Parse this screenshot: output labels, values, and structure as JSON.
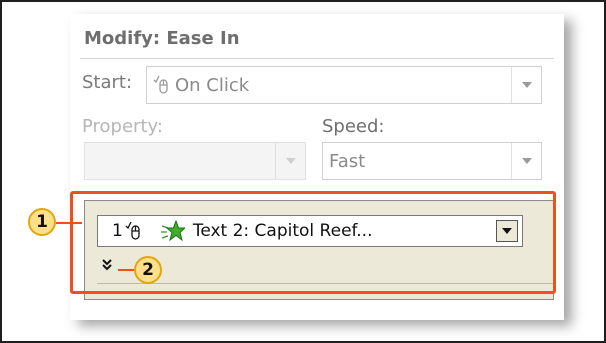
{
  "task_pane": {
    "title": "Modify: Ease In",
    "start": {
      "label": "Start:",
      "value": "On Click",
      "icon": "mouse-icon"
    },
    "property": {
      "label": "Property:",
      "value": ""
    },
    "speed": {
      "label": "Speed:",
      "value": "Fast"
    }
  },
  "animation_list": {
    "items": [
      {
        "number": "1",
        "trigger_icon": "mouse-icon",
        "effect_icon": "entrance-star-icon",
        "label": "Text 2: Capitol Reef..."
      }
    ],
    "expand_icon": "double-chevron-down-icon"
  },
  "callouts": [
    {
      "label": "1"
    },
    {
      "label": "2"
    }
  ],
  "colors": {
    "highlight": "#f0501e",
    "callout_fill": "#fde089",
    "list_background": "#ece9d8"
  }
}
